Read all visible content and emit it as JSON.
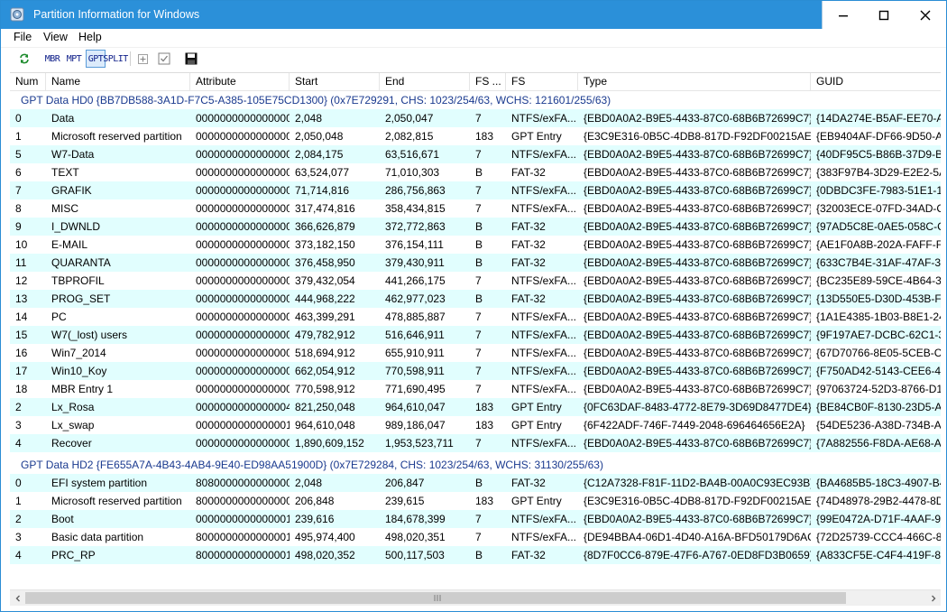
{
  "window": {
    "title": "Partition Information for Windows"
  },
  "menu": [
    "File",
    "View",
    "Help"
  ],
  "toolbar": {
    "mbr": "MBR",
    "mpt": "MPT",
    "gpt": "GPT",
    "split": "SPLIT"
  },
  "columns": [
    "Num",
    "Name",
    "Attribute",
    "Start",
    "End",
    "FS ...",
    "FS",
    "Type",
    "GUID"
  ],
  "groups": [
    {
      "header": "GPT Data HD0 {BB7DB588-3A1D-F7C5-A385-105E75CD1300} (0x7E729291, CHS: 1023/254/63, WCHS: 121601/255/63)",
      "rows": [
        [
          "0",
          "Data",
          "0000000000000000",
          "2,048",
          "2,050,047",
          "7",
          "NTFS/exFA...",
          "{EBD0A0A2-B9E5-4433-87C0-68B6B72699C7}",
          "{14DA274E-B5AF-EE70-A3"
        ],
        [
          "1",
          "Microsoft reserved partition",
          "0000000000000000",
          "2,050,048",
          "2,082,815",
          "183",
          "GPT Entry",
          "{E3C9E316-0B5C-4DB8-817D-F92DF00215AE}",
          "{EB9404AF-DF66-9D50-A3"
        ],
        [
          "5",
          "W7-Data",
          "0000000000000000",
          "2,084,175",
          "63,516,671",
          "7",
          "NTFS/exFA...",
          "{EBD0A0A2-B9E5-4433-87C0-68B6B72699C7}",
          "{40DF95C5-B86B-37D9-BA"
        ],
        [
          "6",
          "TEXT",
          "0000000000000000",
          "63,524,077",
          "71,010,303",
          "B",
          "FAT-32",
          "{EBD0A0A2-B9E5-4433-87C0-68B6B72699C7}",
          "{383F97B4-3D29-E2E2-5A2"
        ],
        [
          "7",
          "GRAFIK",
          "0000000000000000",
          "71,714,816",
          "286,756,863",
          "7",
          "NTFS/exFA...",
          "{EBD0A0A2-B9E5-4433-87C0-68B6B72699C7}",
          "{0DBDC3FE-7983-51E1-12"
        ],
        [
          "8",
          "MISC",
          "0000000000000000",
          "317,474,816",
          "358,434,815",
          "7",
          "NTFS/exFA...",
          "{EBD0A0A2-B9E5-4433-87C0-68B6B72699C7}",
          "{32003ECE-07FD-34AD-C6"
        ],
        [
          "9",
          "I_DWNLD",
          "0000000000000000",
          "366,626,879",
          "372,772,863",
          "B",
          "FAT-32",
          "{EBD0A0A2-B9E5-4433-87C0-68B6B72699C7}",
          "{97AD5C8E-0AE5-058C-C8"
        ],
        [
          "10",
          "E-MAIL",
          "0000000000000000",
          "373,182,150",
          "376,154,111",
          "B",
          "FAT-32",
          "{EBD0A0A2-B9E5-4433-87C0-68B6B72699C7}",
          "{AE1F0A8B-202A-FAFF-F9"
        ],
        [
          "11",
          "QUARANTA",
          "0000000000000000",
          "376,458,950",
          "379,430,911",
          "B",
          "FAT-32",
          "{EBD0A0A2-B9E5-4433-87C0-68B6B72699C7}",
          "{633C7B4E-31AF-47AF-3B"
        ],
        [
          "12",
          "TBPROFIL",
          "0000000000000000",
          "379,432,054",
          "441,266,175",
          "7",
          "NTFS/exFA...",
          "{EBD0A0A2-B9E5-4433-87C0-68B6B72699C7}",
          "{BC235E89-59CE-4B64-348"
        ],
        [
          "13",
          "PROG_SET",
          "0000000000000000",
          "444,968,222",
          "462,977,023",
          "B",
          "FAT-32",
          "{EBD0A0A2-B9E5-4433-87C0-68B6B72699C7}",
          "{13D550E5-D30D-453B-F28"
        ],
        [
          "14",
          "PC",
          "0000000000000000",
          "463,399,291",
          "478,885,887",
          "7",
          "NTFS/exFA...",
          "{EBD0A0A2-B9E5-4433-87C0-68B6B72699C7}",
          "{1A1E4385-1B03-B8E1-248"
        ],
        [
          "15",
          "W7(_lost) users",
          "0000000000000000",
          "479,782,912",
          "516,646,911",
          "7",
          "NTFS/exFA...",
          "{EBD0A0A2-B9E5-4433-87C0-68B6B72699C7}",
          "{9F197AE7-DCBC-62C1-39"
        ],
        [
          "16",
          "Win7_2014",
          "0000000000000000",
          "518,694,912",
          "655,910,911",
          "7",
          "NTFS/exFA...",
          "{EBD0A0A2-B9E5-4433-87C0-68B6B72699C7}",
          "{67D70766-8E05-5CEB-CF9"
        ],
        [
          "17",
          "Win10_Koy",
          "0000000000000000",
          "662,054,912",
          "770,598,911",
          "7",
          "NTFS/exFA...",
          "{EBD0A0A2-B9E5-4433-87C0-68B6B72699C7}",
          "{F750AD42-5143-CEE6-471"
        ],
        [
          "18",
          "MBR Entry 1",
          "0000000000000000",
          "770,598,912",
          "771,690,495",
          "7",
          "NTFS/exFA...",
          "{EBD0A0A2-B9E5-4433-87C0-68B6B72699C7}",
          "{97063724-52D3-8766-D1D"
        ],
        [
          "2",
          "Lx_Rosa",
          "0000000000000004",
          "821,250,048",
          "964,610,047",
          "183",
          "GPT Entry",
          "{0FC63DAF-8483-4772-8E79-3D69D8477DE4}",
          "{BE84CB0F-8130-23D5-A3"
        ],
        [
          "3",
          "Lx_swap",
          "0000000000000001",
          "964,610,048",
          "989,186,047",
          "183",
          "GPT Entry",
          "{6F422ADF-746F-7449-2048-696464656E2A}",
          "{54DE5236-A38D-734B-A3"
        ],
        [
          "4",
          "Recover",
          "0000000000000000",
          "1,890,609,152",
          "1,953,523,711",
          "7",
          "NTFS/exFA...",
          "{EBD0A0A2-B9E5-4433-87C0-68B6B72699C7}",
          "{7A882556-F8DA-AE68-A3"
        ]
      ]
    },
    {
      "header": "GPT Data HD2 {FE655A7A-4B43-4AB4-9E40-ED98AA51900D} (0x7E729284, CHS: 1023/254/63, WCHS: 31130/255/63)",
      "rows": [
        [
          "0",
          "EFI system partition",
          "8080000000000000",
          "2,048",
          "206,847",
          "B",
          "FAT-32",
          "{C12A7328-F81F-11D2-BA4B-00A0C93EC93B}",
          "{BA4685B5-18C3-4907-B49"
        ],
        [
          "1",
          "Microsoft reserved partition",
          "8000000000000000",
          "206,848",
          "239,615",
          "183",
          "GPT Entry",
          "{E3C9E316-0B5C-4DB8-817D-F92DF00215AE}",
          "{74D48978-29B2-4478-8DA"
        ],
        [
          "2",
          "Boot",
          "0000000000000001",
          "239,616",
          "184,678,399",
          "7",
          "NTFS/exFA...",
          "{EBD0A0A2-B9E5-4433-87C0-68B6B72699C7}",
          "{99E0472A-D71F-4AAF-97"
        ],
        [
          "3",
          "Basic data partition",
          "8000000000000001",
          "495,974,400",
          "498,020,351",
          "7",
          "NTFS/exFA...",
          "{DE94BBA4-06D1-4D40-A16A-BFD50179D6AC}",
          "{72D25739-CCC4-466C-82"
        ],
        [
          "4",
          "PRC_RP",
          "8000000000000001",
          "498,020,352",
          "500,117,503",
          "B",
          "FAT-32",
          "{8D7F0CC6-879E-47F6-A767-0ED8FD3B0659}",
          "{A833CF5E-C4F4-419F-81A"
        ]
      ]
    }
  ]
}
